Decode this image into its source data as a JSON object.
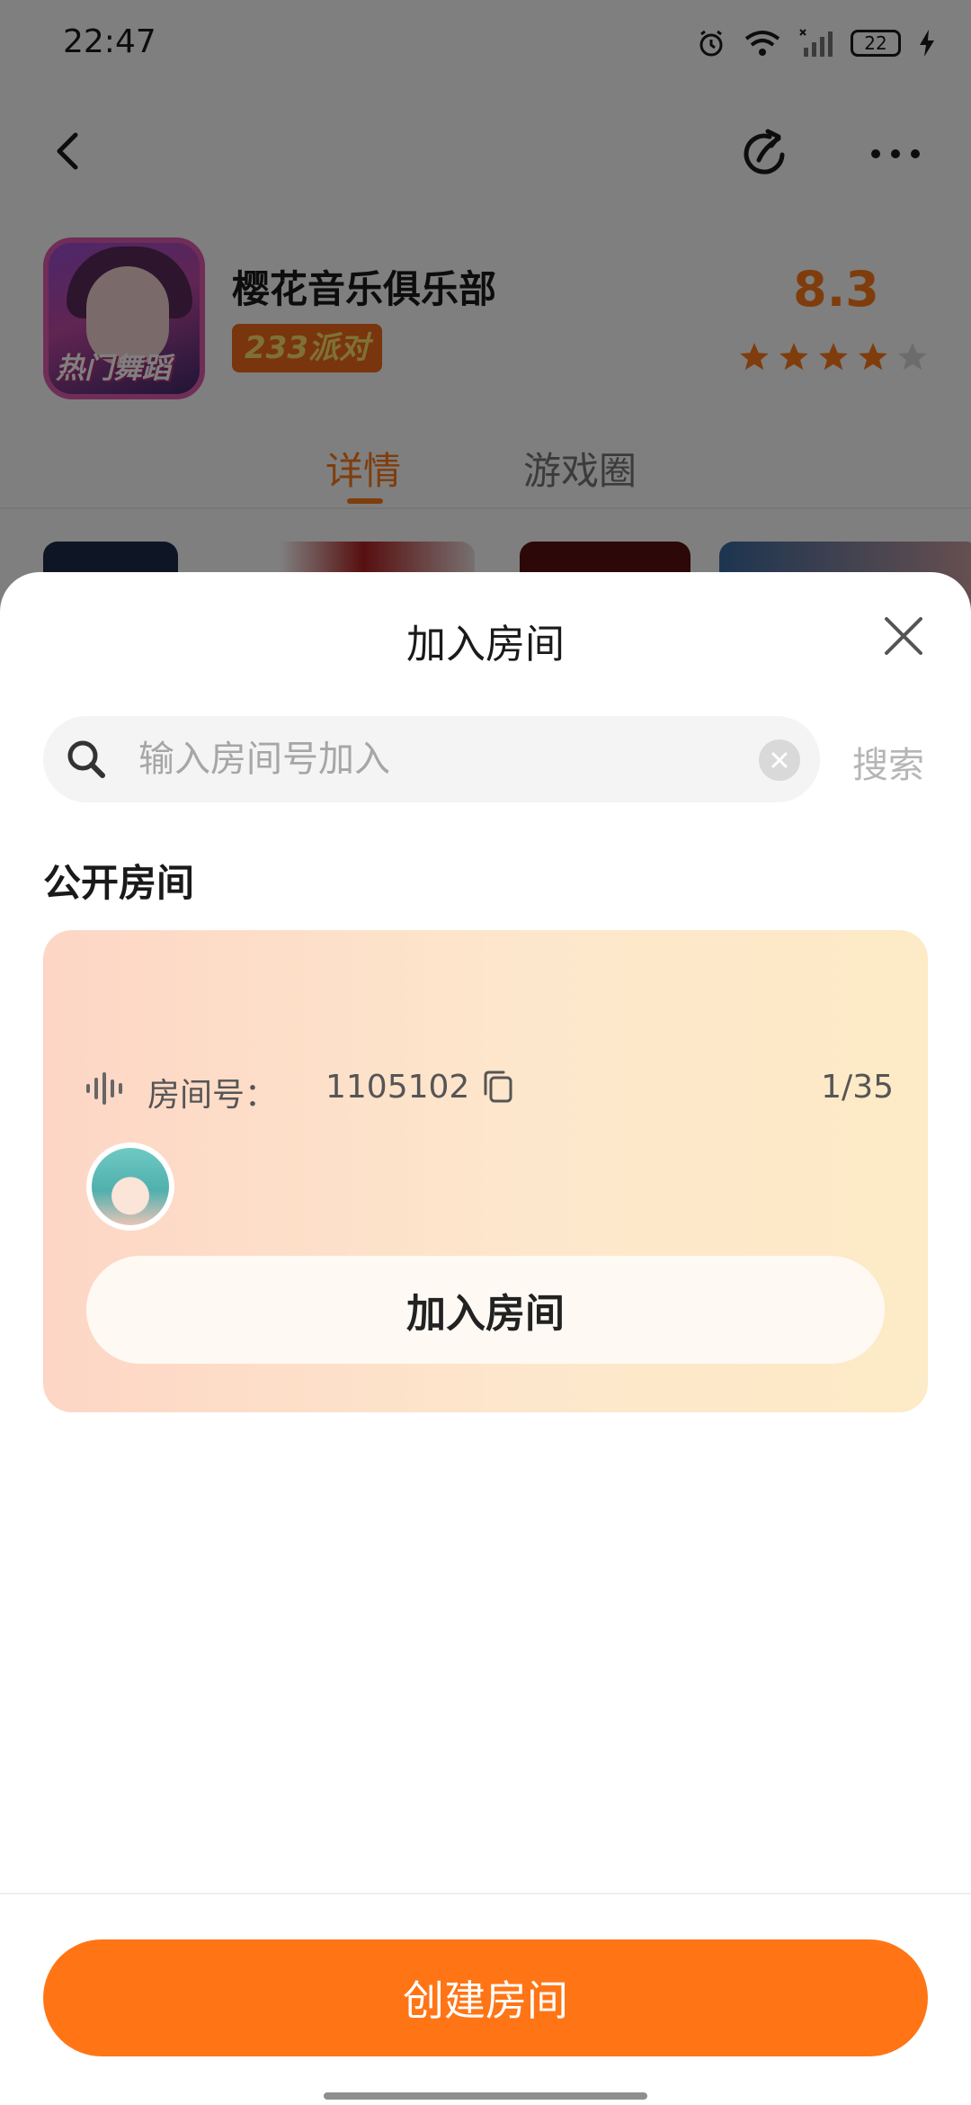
{
  "status_bar": {
    "time": "22:47",
    "battery": "22"
  },
  "app": {
    "name": "樱花音乐俱乐部",
    "badge": "233派对",
    "icon_text": "热门舞蹈",
    "rating": "8.3",
    "stars": 4.5
  },
  "tabs": [
    {
      "label": "详情",
      "active": true
    },
    {
      "label": "游戏圈",
      "active": false
    }
  ],
  "sheet": {
    "title": "加入房间",
    "search_placeholder": "输入房间号加入",
    "search_button": "搜索",
    "section_title": "公开房间",
    "room": {
      "number_label": "房间号：",
      "number": "1105102",
      "count": "1/35",
      "join_label": "加入房间"
    },
    "create_label": "创建房间"
  },
  "colors": {
    "accent": "#ff7516",
    "card_start": "#fdd6c5",
    "card_end": "#fdeac6"
  },
  "icons": [
    "back-icon",
    "share-icon",
    "more-icon",
    "close-icon",
    "search-icon",
    "clear-icon",
    "voice-icon",
    "copy-icon"
  ]
}
